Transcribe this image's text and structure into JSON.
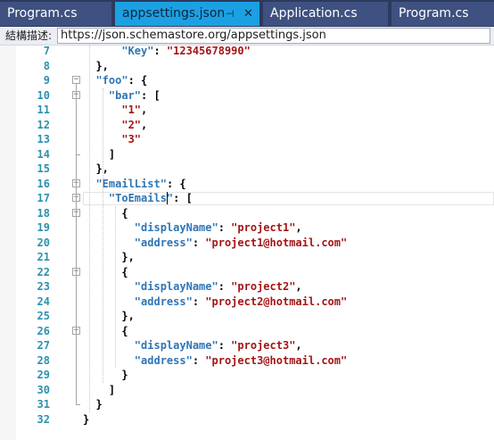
{
  "tabs": [
    {
      "label": "Program.cs",
      "active": false
    },
    {
      "label": "appsettings.json",
      "active": true,
      "pin_icon": "pin-icon",
      "close_icon": "close-icon"
    },
    {
      "label": "Application.cs",
      "active": false
    },
    {
      "label": "Program.cs",
      "active": false
    }
  ],
  "schema": {
    "label": "結構描述:",
    "url": "https://json.schemastore.org/appsettings.json"
  },
  "editor": {
    "current_line": 17,
    "lines": [
      {
        "n": "7",
        "tokens": [
          {
            "t": "key",
            "v": "\"Key\""
          },
          {
            "t": "pun",
            "v": ": "
          },
          {
            "t": "str",
            "v": "\"12345678990\""
          }
        ]
      },
      {
        "n": "8",
        "tokens": [
          {
            "t": "pun",
            "v": "},"
          }
        ]
      },
      {
        "n": "9",
        "tokens": [
          {
            "t": "key",
            "v": "\"foo\""
          },
          {
            "t": "pun",
            "v": ": {"
          }
        ]
      },
      {
        "n": "10",
        "tokens": [
          {
            "t": "key",
            "v": "\"bar\""
          },
          {
            "t": "pun",
            "v": ": ["
          }
        ]
      },
      {
        "n": "11",
        "tokens": [
          {
            "t": "str",
            "v": "\"1\""
          },
          {
            "t": "pun",
            "v": ","
          }
        ]
      },
      {
        "n": "12",
        "tokens": [
          {
            "t": "str",
            "v": "\"2\""
          },
          {
            "t": "pun",
            "v": ","
          }
        ]
      },
      {
        "n": "13",
        "tokens": [
          {
            "t": "str",
            "v": "\"3\""
          }
        ]
      },
      {
        "n": "14",
        "tokens": [
          {
            "t": "pun",
            "v": "]"
          }
        ]
      },
      {
        "n": "15",
        "tokens": [
          {
            "t": "pun",
            "v": "},"
          }
        ]
      },
      {
        "n": "16",
        "tokens": [
          {
            "t": "key",
            "v": "\"EmailList\""
          },
          {
            "t": "pun",
            "v": ": {"
          }
        ]
      },
      {
        "n": "17",
        "tokens": [
          {
            "t": "key",
            "v": "\"ToEmails\""
          },
          {
            "t": "pun",
            "v": ": ["
          }
        ]
      },
      {
        "n": "18",
        "tokens": [
          {
            "t": "pun",
            "v": "{"
          }
        ]
      },
      {
        "n": "19",
        "tokens": [
          {
            "t": "key",
            "v": "\"displayName\""
          },
          {
            "t": "pun",
            "v": ": "
          },
          {
            "t": "str",
            "v": "\"project1\""
          },
          {
            "t": "pun",
            "v": ","
          }
        ]
      },
      {
        "n": "20",
        "tokens": [
          {
            "t": "key",
            "v": "\"address\""
          },
          {
            "t": "pun",
            "v": ": "
          },
          {
            "t": "str",
            "v": "\"project1@hotmail.com\""
          }
        ]
      },
      {
        "n": "21",
        "tokens": [
          {
            "t": "pun",
            "v": "},"
          }
        ]
      },
      {
        "n": "22",
        "tokens": [
          {
            "t": "pun",
            "v": "{"
          }
        ]
      },
      {
        "n": "23",
        "tokens": [
          {
            "t": "key",
            "v": "\"displayName\""
          },
          {
            "t": "pun",
            "v": ": "
          },
          {
            "t": "str",
            "v": "\"project2\""
          },
          {
            "t": "pun",
            "v": ","
          }
        ]
      },
      {
        "n": "24",
        "tokens": [
          {
            "t": "key",
            "v": "\"address\""
          },
          {
            "t": "pun",
            "v": ": "
          },
          {
            "t": "str",
            "v": "\"project2@hotmail.com\""
          }
        ]
      },
      {
        "n": "25",
        "tokens": [
          {
            "t": "pun",
            "v": "},"
          }
        ]
      },
      {
        "n": "26",
        "tokens": [
          {
            "t": "pun",
            "v": "{"
          }
        ]
      },
      {
        "n": "27",
        "tokens": [
          {
            "t": "key",
            "v": "\"displayName\""
          },
          {
            "t": "pun",
            "v": ": "
          },
          {
            "t": "str",
            "v": "\"project3\""
          },
          {
            "t": "pun",
            "v": ","
          }
        ]
      },
      {
        "n": "28",
        "tokens": [
          {
            "t": "key",
            "v": "\"address\""
          },
          {
            "t": "pun",
            "v": ": "
          },
          {
            "t": "str",
            "v": "\"project3@hotmail.com\""
          }
        ]
      },
      {
        "n": "29",
        "tokens": [
          {
            "t": "pun",
            "v": "}"
          }
        ]
      },
      {
        "n": "30",
        "tokens": [
          {
            "t": "pun",
            "v": "]"
          }
        ]
      },
      {
        "n": "31",
        "tokens": [
          {
            "t": "pun",
            "v": "}"
          }
        ]
      },
      {
        "n": "32",
        "tokens": [
          {
            "t": "pun",
            "v": "}"
          }
        ]
      }
    ]
  },
  "colors": {
    "tab_active": "#1ba1e2",
    "tab_inactive": "#3e5180",
    "json_key": "#2e75b6",
    "json_string": "#a31515",
    "line_number": "#2b91af"
  }
}
